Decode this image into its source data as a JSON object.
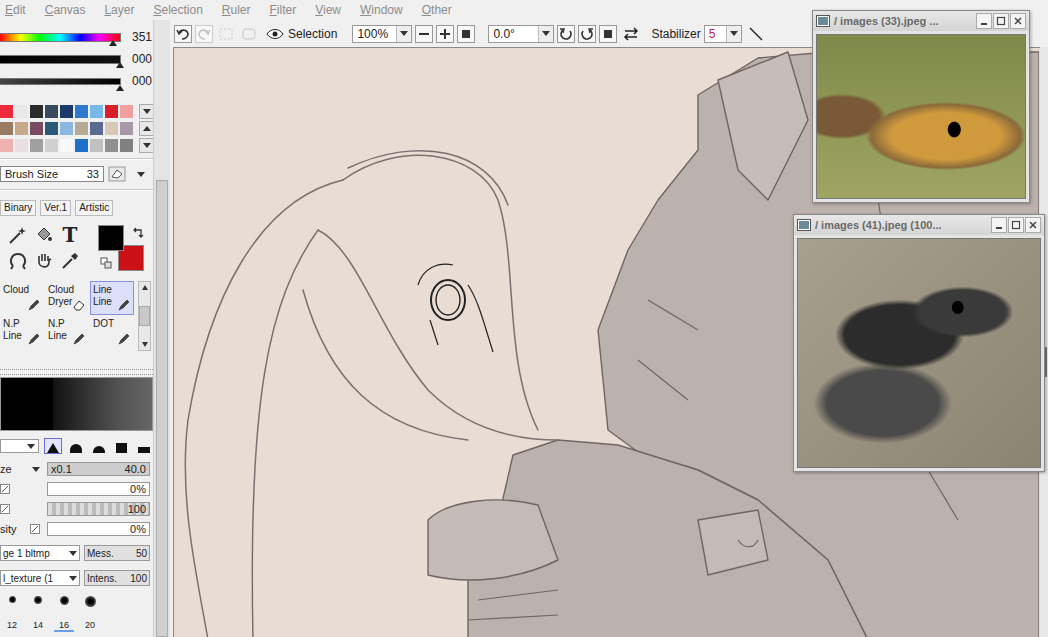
{
  "menu": [
    "Edit",
    "Canvas",
    "Layer",
    "Selection",
    "Ruler",
    "Filter",
    "View",
    "Window",
    "Other"
  ],
  "color_sliders": [
    {
      "kind": "hue",
      "reading": "351",
      "level": 0.94
    },
    {
      "kind": "dark",
      "reading": "000",
      "level": 1
    },
    {
      "kind": "light",
      "reading": "000",
      "level": 1
    }
  ],
  "swatch_rows": [
    [
      "#ee2a3c",
      "#e8e8e8",
      "#2b2b2b",
      "#3a4a5c",
      "#1b3a6b",
      "#2f78d0",
      "#78b8e8",
      "#d81e28",
      "#f0a0a0"
    ],
    [
      "#9a7a60",
      "#c8a888",
      "#7a4a60",
      "#2a5a78",
      "#8ab8e0",
      "#b8a898",
      "#5a6a90",
      "#d8c8b8",
      "#a898a8"
    ],
    [
      "#f0b0b0",
      "#e8e0e0",
      "#a0a0a0",
      "#d0d0d0",
      "#f8f8f8",
      "#1e70c8",
      "#c0c0c0",
      "#909090",
      "#808080"
    ]
  ],
  "brush_size": {
    "label": "Brush Size",
    "value": "33"
  },
  "tool_tabs": [
    {
      "label": "Binary",
      "selected": false
    },
    {
      "label": "Ver.1",
      "selected": false
    },
    {
      "label": "Artistic",
      "selected": false
    }
  ],
  "text_tool": "T",
  "primary_color": "#000000",
  "secondary_color": "#cc1018",
  "tools": [
    {
      "lines": [
        "Cloud"
      ],
      "kind": "pen",
      "selected": false
    },
    {
      "lines": [
        "Cloud",
        "Dryer"
      ],
      "kind": "eraser",
      "selected": false
    },
    {
      "lines": [
        "Line",
        "Line"
      ],
      "kind": "pen",
      "selected": true
    },
    {
      "lines": [
        "N.P",
        "Line"
      ],
      "kind": "pen",
      "selected": false
    },
    {
      "lines": [
        "N.P",
        "Line"
      ],
      "kind": "pen",
      "selected": false
    },
    {
      "lines": [
        "DOT"
      ],
      "kind": "pen",
      "selected": false
    }
  ],
  "brush_shapes": [
    {
      "kind": "cone",
      "selected": true
    },
    {
      "kind": "bell",
      "selected": false
    },
    {
      "kind": "dome",
      "selected": false
    },
    {
      "kind": "square",
      "selected": false
    },
    {
      "kind": "flat",
      "selected": false
    }
  ],
  "brush_settings": [
    {
      "label": "ze",
      "scale": "x0.1",
      "reading": "40.0",
      "level": 1,
      "kind": "size"
    },
    {
      "reading": "0%",
      "level": 0,
      "kind": "percent"
    },
    {
      "reading": "100",
      "level": 1,
      "kind": "checker"
    },
    {
      "label": "sity",
      "reading": "0%",
      "level": 0,
      "kind": "percent"
    }
  ],
  "texture_rows": [
    {
      "dropdown": "ge 1 bltmp",
      "label": "Mess.",
      "reading": "50"
    },
    {
      "dropdown": "l_texture (1",
      "label": "Intens.",
      "reading": "100"
    }
  ],
  "brush_presets": [
    {
      "size": "12",
      "selected": false
    },
    {
      "size": "14",
      "selected": false
    },
    {
      "size": "16",
      "selected": true
    },
    {
      "size": "20",
      "selected": false
    }
  ],
  "toolbar": {
    "selection_label": "Selection",
    "zoom": "100%",
    "rotation": "0.0°",
    "stabilizer_label": "Stabilizer",
    "stabilizer": "5",
    "redo_enabled": false
  },
  "windows": [
    {
      "title": "/ images (33).jpeg ...",
      "kind": "yellow-snake"
    },
    {
      "title": "/ images (41).jpeg (100...",
      "kind": "black-snake"
    }
  ]
}
